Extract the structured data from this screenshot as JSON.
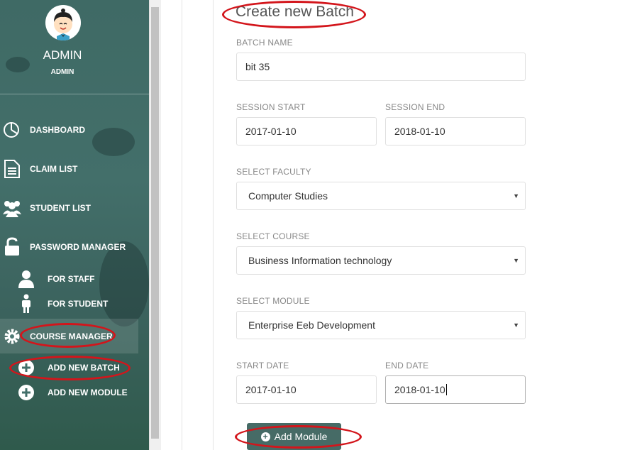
{
  "user": {
    "name": "ADMIN",
    "role": "ADMIN"
  },
  "nav": {
    "dashboard": "DASHBOARD",
    "claim_list": "CLAIM LIST",
    "student_list": "STUDENT LIST",
    "password_manager": "PASSWORD MANAGER",
    "for_staff": "FOR STAFF",
    "for_student": "FOR STUDENT",
    "course_manager": "COURSE MANAGER",
    "add_new_batch": "ADD NEW BATCH",
    "add_new_module": "ADD NEW MODULE"
  },
  "form": {
    "title": "Create new Batch",
    "batch_name": {
      "label": "BATCH NAME",
      "value": "bit 35"
    },
    "session_start": {
      "label": "SESSION START",
      "value": "2017-01-10"
    },
    "session_end": {
      "label": "SESSION END",
      "value": "2018-01-10"
    },
    "faculty": {
      "label": "SELECT FACULTY",
      "value": "Computer Studies"
    },
    "course": {
      "label": "SELECT COURSE",
      "value": "Business Information technology"
    },
    "module": {
      "label": "SELECT MODULE",
      "value": "Enterprise Eeb Development"
    },
    "start_date": {
      "label": "START DATE",
      "value": "2017-01-10"
    },
    "end_date": {
      "label": "END DATE",
      "value": "2018-01-10"
    },
    "submit_label": "Add Module"
  },
  "colors": {
    "sidebar": "#436f6a",
    "button": "#466b66",
    "annotation": "#d3151b"
  }
}
